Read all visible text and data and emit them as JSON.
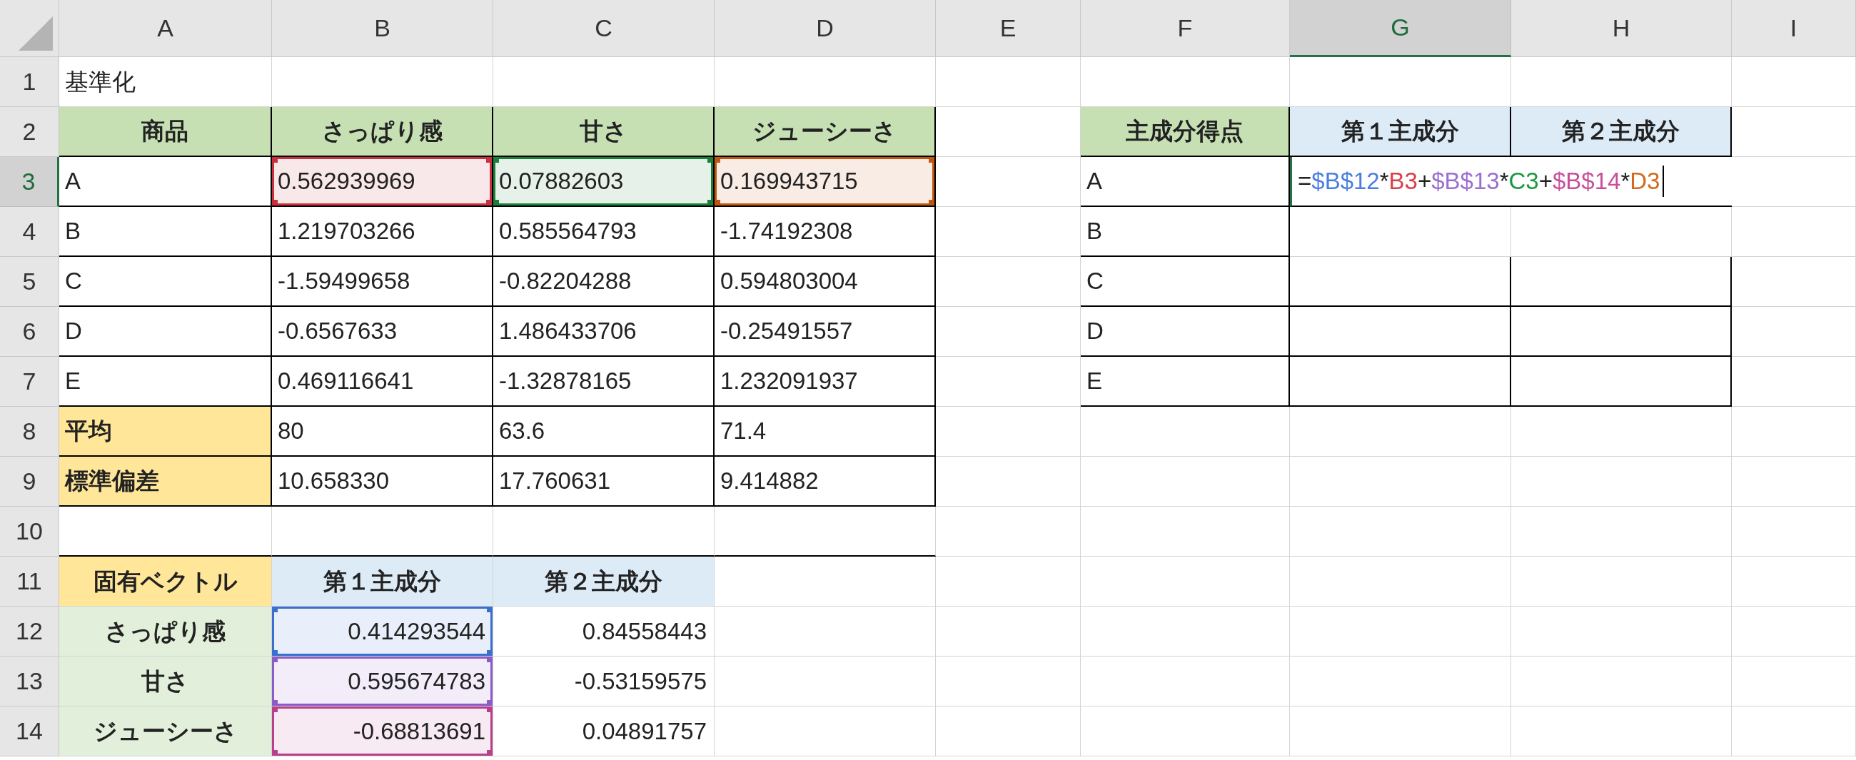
{
  "columns": [
    {
      "label": "A",
      "selected": false
    },
    {
      "label": "B",
      "selected": false
    },
    {
      "label": "C",
      "selected": false
    },
    {
      "label": "D",
      "selected": false
    },
    {
      "label": "E",
      "selected": false
    },
    {
      "label": "F",
      "selected": false
    },
    {
      "label": "G",
      "selected": true
    },
    {
      "label": "H",
      "selected": false
    },
    {
      "label": "I",
      "selected": false
    }
  ],
  "rows": [
    {
      "label": "1",
      "selected": false,
      "cells": [
        {
          "kind": "plain",
          "text": "基準化"
        },
        null,
        null,
        null,
        null,
        null,
        null,
        null,
        null
      ]
    },
    {
      "label": "2",
      "selected": false,
      "cells": [
        {
          "kind": "header",
          "text": "商品",
          "color": "#c6e0b4"
        },
        {
          "kind": "header",
          "text": "さっぱり感",
          "color": "#c6e0b4"
        },
        {
          "kind": "header",
          "text": "甘さ",
          "color": "#c6e0b4"
        },
        {
          "kind": "header",
          "text": "ジューシーさ",
          "color": "#c6e0b4"
        },
        null,
        {
          "kind": "header",
          "text": "主成分得点",
          "color": "#c6e0b4"
        },
        {
          "kind": "header",
          "text": "第１主成分",
          "color": "#ddebf7"
        },
        {
          "kind": "header",
          "text": "第２主成分",
          "color": "#ddebf7"
        },
        null
      ]
    },
    {
      "label": "3",
      "selected": true,
      "cells": [
        {
          "kind": "boxed",
          "text": "A"
        },
        {
          "kind": "boxed",
          "text": "0.562939969",
          "reference": {
            "color": "#c8303c"
          }
        },
        {
          "kind": "boxed",
          "text": "0.07882603",
          "reference": {
            "color": "#1a7f37"
          }
        },
        {
          "kind": "boxed",
          "text": "0.169943715",
          "reference": {
            "color": "#c0560e"
          }
        },
        null,
        {
          "kind": "boxed",
          "text": "A"
        },
        {
          "kind": "formula",
          "parts": [
            {
              "text": "=",
              "color": "#222222"
            },
            {
              "text": "$B$12",
              "color": "#4a7fe0"
            },
            {
              "text": "*",
              "color": "#222222"
            },
            {
              "text": "B3",
              "color": "#d9404a"
            },
            {
              "text": "+",
              "color": "#222222"
            },
            {
              "text": "$B$13",
              "color": "#9a6fd0"
            },
            {
              "text": "*",
              "color": "#222222"
            },
            {
              "text": "C3",
              "color": "#1a9a40"
            },
            {
              "text": "+",
              "color": "#222222"
            },
            {
              "text": "$B$14",
              "color": "#c8509a"
            },
            {
              "text": "*",
              "color": "#222222"
            },
            {
              "text": "D3",
              "color": "#d2691e"
            }
          ]
        },
        null,
        null
      ]
    },
    {
      "label": "4",
      "selected": false,
      "cells": [
        {
          "kind": "boxed",
          "text": "B"
        },
        {
          "kind": "boxed",
          "text": "1.219703266"
        },
        {
          "kind": "boxed",
          "text": "0.585564793"
        },
        {
          "kind": "boxed",
          "text": "-1.74192308"
        },
        null,
        {
          "kind": "boxed",
          "text": "B"
        },
        null,
        null,
        null
      ]
    },
    {
      "label": "5",
      "selected": false,
      "cells": [
        {
          "kind": "boxed",
          "text": "C"
        },
        {
          "kind": "boxed",
          "text": "-1.59499658"
        },
        {
          "kind": "boxed",
          "text": "-0.82204288"
        },
        {
          "kind": "boxed",
          "text": "0.594803004"
        },
        null,
        {
          "kind": "boxed",
          "text": "C"
        },
        {
          "kind": "boxed"
        },
        {
          "kind": "boxed"
        },
        null
      ]
    },
    {
      "label": "6",
      "selected": false,
      "cells": [
        {
          "kind": "boxed",
          "text": "D"
        },
        {
          "kind": "boxed",
          "text": "-0.6567633"
        },
        {
          "kind": "boxed",
          "text": "1.486433706"
        },
        {
          "kind": "boxed",
          "text": "-0.25491557"
        },
        null,
        {
          "kind": "boxed",
          "text": "D"
        },
        {
          "kind": "boxed"
        },
        {
          "kind": "boxed"
        },
        null
      ]
    },
    {
      "label": "7",
      "selected": false,
      "cells": [
        {
          "kind": "boxed",
          "text": "E"
        },
        {
          "kind": "boxed",
          "text": "0.469116641"
        },
        {
          "kind": "boxed",
          "text": "-1.32878165"
        },
        {
          "kind": "boxed",
          "text": "1.232091937"
        },
        null,
        {
          "kind": "boxed",
          "text": "E"
        },
        {
          "kind": "boxed"
        },
        {
          "kind": "boxed"
        },
        null
      ]
    },
    {
      "label": "8",
      "selected": false,
      "cells": [
        {
          "kind": "boxed-label",
          "text": "平均",
          "color": "#ffe699"
        },
        {
          "kind": "boxed",
          "text": "80"
        },
        {
          "kind": "boxed",
          "text": "63.6"
        },
        {
          "kind": "boxed",
          "text": "71.4"
        },
        null,
        null,
        null,
        null,
        null
      ]
    },
    {
      "label": "9",
      "selected": false,
      "cells": [
        {
          "kind": "boxed-label",
          "text": "標準偏差",
          "color": "#ffe699"
        },
        {
          "kind": "boxed",
          "text": "10.658330"
        },
        {
          "kind": "boxed",
          "text": "17.760631"
        },
        {
          "kind": "boxed",
          "text": "9.414882"
        },
        null,
        null,
        null,
        null,
        null
      ]
    },
    {
      "label": "10",
      "selected": false,
      "cells": [
        {
          "kind": "rule"
        },
        {
          "kind": "rule"
        },
        {
          "kind": "rule"
        },
        {
          "kind": "rule"
        },
        null,
        null,
        null,
        null,
        null
      ]
    },
    {
      "label": "11",
      "selected": false,
      "cells": [
        {
          "kind": "filled",
          "text": "固有ベクトル",
          "color": "#ffe699"
        },
        {
          "kind": "filled",
          "text": "第１主成分",
          "color": "#ddebf7"
        },
        {
          "kind": "filled",
          "text": "第２主成分",
          "color": "#ddebf7"
        },
        null,
        null,
        null,
        null,
        null,
        null
      ]
    },
    {
      "label": "12",
      "selected": false,
      "cells": [
        {
          "kind": "filled",
          "text": "さっぱり感",
          "color": "#e2efda"
        },
        {
          "kind": "value",
          "text": "0.414293544",
          "reference": {
            "color": "#3a6fd0"
          }
        },
        {
          "kind": "value",
          "text": "0.84558443"
        },
        null,
        null,
        null,
        null,
        null,
        null
      ]
    },
    {
      "label": "13",
      "selected": false,
      "cells": [
        {
          "kind": "filled",
          "text": "甘さ",
          "color": "#e2efda"
        },
        {
          "kind": "value",
          "text": "0.595674783",
          "reference": {
            "color": "#8a5cc8"
          }
        },
        {
          "kind": "value",
          "text": "-0.53159575"
        },
        null,
        null,
        null,
        null,
        null,
        null
      ]
    },
    {
      "label": "14",
      "selected": false,
      "cells": [
        {
          "kind": "filled",
          "text": "ジューシーさ",
          "color": "#e2efda"
        },
        {
          "kind": "value",
          "text": "-0.68813691",
          "reference": {
            "color": "#b8408a"
          }
        },
        {
          "kind": "value",
          "text": "0.04891757"
        },
        null,
        null,
        null,
        null,
        null,
        null
      ]
    }
  ]
}
